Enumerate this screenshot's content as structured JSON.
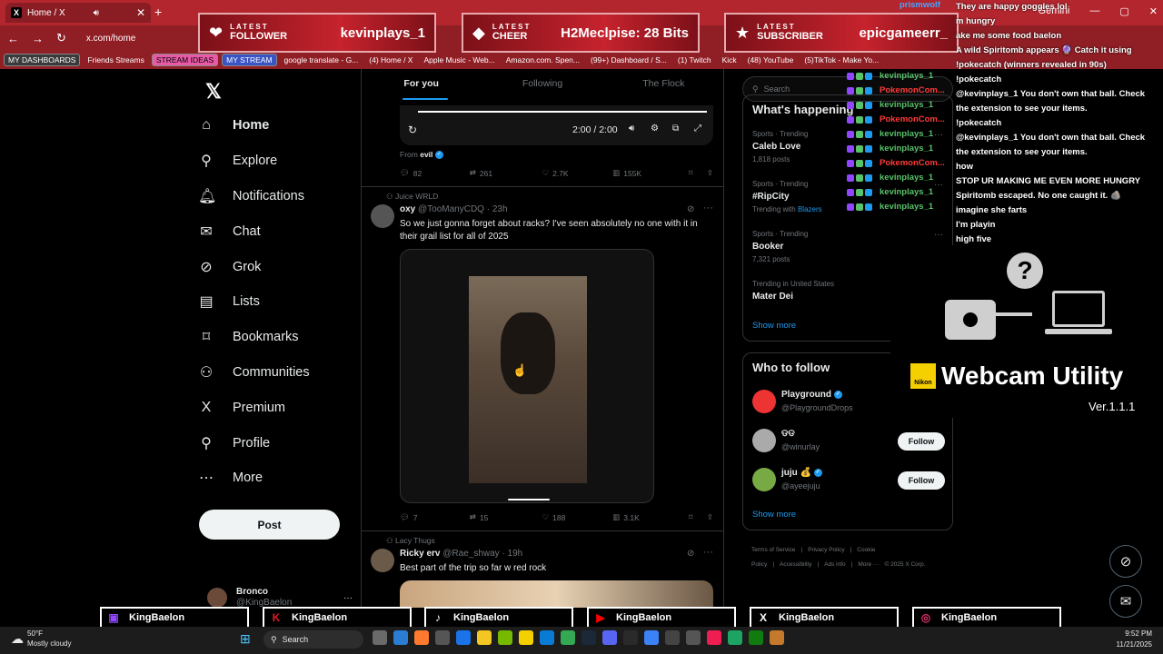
{
  "browser": {
    "tab_title": "Home / X",
    "url": "x.com/home",
    "bookmarks": [
      "MY DASHBOARDS",
      "Friends Streams",
      "STREAM IDEAS",
      "MY STREAM",
      "google translate - G...",
      "(4) Home / X",
      "Apple Music - Web...",
      "Amazon.com. Spen...",
      "(99+) Dashboard / S...",
      "(1) Twitch",
      "Kick",
      "(48) YouTube",
      "(5)TikTok - Make Yo..."
    ],
    "gemini_label": "Gemini"
  },
  "alerts": {
    "follower": {
      "label_top": "LATEST",
      "label": "FOLLOWER",
      "value": "kevinplays_1"
    },
    "cheer": {
      "label_top": "LATEST",
      "label": "CHEER",
      "value": "H2Meclpise: 28 Bits"
    },
    "subscriber": {
      "label_top": "LATEST",
      "label": "SUBSCRIBER",
      "value": "epicgameerr_"
    }
  },
  "nav": {
    "items": [
      {
        "label": "Home",
        "icon": "home-icon",
        "glyph": "⌂"
      },
      {
        "label": "Explore",
        "icon": "search-icon",
        "glyph": "⚲"
      },
      {
        "label": "Notifications",
        "icon": "bell-icon",
        "glyph": "🔔︎"
      },
      {
        "label": "Chat",
        "icon": "mail-icon",
        "glyph": "✉"
      },
      {
        "label": "Grok",
        "icon": "grok-icon",
        "glyph": "⊘"
      },
      {
        "label": "Lists",
        "icon": "list-icon",
        "glyph": "▤"
      },
      {
        "label": "Bookmarks",
        "icon": "bookmark-icon",
        "glyph": "⌑"
      },
      {
        "label": "Communities",
        "icon": "people-icon",
        "glyph": "⚇"
      },
      {
        "label": "Premium",
        "icon": "x-icon",
        "glyph": "X"
      },
      {
        "label": "Profile",
        "icon": "person-icon",
        "glyph": "⚲"
      },
      {
        "label": "More",
        "icon": "more-icon",
        "glyph": "⋯"
      }
    ],
    "post_label": "Post",
    "profile_name": "Bronco",
    "profile_handle": "@KingBaelon"
  },
  "feed": {
    "tabs": [
      "For you",
      "Following",
      "The Flock"
    ],
    "video_time": "2:00 / 2:00",
    "from_label": "From",
    "from_name": "evil",
    "tweet0_stats": {
      "replies": "82",
      "reposts": "261",
      "likes": "2.7K",
      "views": "155K"
    },
    "tweet1": {
      "context": "Juice WRLD",
      "name": "oxy",
      "handle": "@TooManyCDQ · 23h",
      "text": "So we just gonna forget about racks? I've seen absolutely no one with it in their grail list for all of 2025",
      "stats": {
        "replies": "7",
        "reposts": "15",
        "likes": "188",
        "views": "3.1K"
      }
    },
    "tweet2": {
      "context": "Lacy Thugs",
      "name": "Ricky erv",
      "handle": "@Rae_shway · 19h",
      "text": "Best part of the trip so far w red rock"
    }
  },
  "right": {
    "search_placeholder": "Search",
    "happening_title": "What's happening",
    "trends": [
      {
        "cat": "Sports · Trending",
        "name": "Caleb Love",
        "count": "1,818 posts"
      },
      {
        "cat": "Sports · Trending",
        "name": "#RipCity",
        "count": "Trending with",
        "extra": "Blazers"
      },
      {
        "cat": "Sports · Trending",
        "name": "Booker",
        "count": "7,321 posts"
      },
      {
        "cat": "Trending in United States",
        "name": "Mater Dei",
        "count": ""
      }
    ],
    "show_more": "Show more",
    "who_title": "Who to follow",
    "follow": [
      {
        "name": "Playground",
        "handle": "@PlaygroundDrops",
        "button": ""
      },
      {
        "name": "ଡଡ",
        "handle": "@winurlay",
        "button": "Follow"
      },
      {
        "name": "juju 💰",
        "handle": "@ayeejuju",
        "button": "Follow"
      }
    ],
    "footer": [
      "Terms of Service",
      "|",
      "Privacy Policy",
      "|",
      "Cookie Policy",
      "|",
      "Accessibility",
      "|",
      "Ads info",
      "|",
      "More ···",
      "© 2025 X Corp."
    ]
  },
  "chat": {
    "lines": [
      "They are happy goggles lol",
      "m hungry",
      "ake me some food baelon",
      "A wild Spiritomb appears 🔮 Catch it using",
      "!pokecatch (winners revealed in 90s)",
      "!pokecatch",
      "@kevinplays_1 You don't own that ball. Check",
      "the extension to see your items.",
      "!pokecatch",
      "@kevinplays_1 You don't own that ball. Check",
      "the extension to see your items.",
      "how",
      "STOP UR MAKING ME EVEN MORE HUNGRY",
      "Spiritomb escaped. No one caught it. 🪨",
      "imagine she farts",
      "I'm playin",
      "high five"
    ],
    "top_user": "prismwolf",
    "names": [
      {
        "name": "kevinplays_1",
        "color": "#59c36a"
      },
      {
        "name": "PokemonCom...",
        "color": "#ff3b3b"
      },
      {
        "name": "kevinplays_1",
        "color": "#59c36a"
      },
      {
        "name": "PokemonCom...",
        "color": "#ff3b3b"
      },
      {
        "name": "kevinplays_1",
        "color": "#59c36a"
      },
      {
        "name": "kevinplays_1",
        "color": "#59c36a"
      },
      {
        "name": "PokemonCom...",
        "color": "#ff3b3b"
      },
      {
        "name": "kevinplays_1",
        "color": "#59c36a"
      },
      {
        "name": "kevinplays_1",
        "color": "#59c36a"
      },
      {
        "name": "kevinplays_1",
        "color": "#59c36a"
      }
    ]
  },
  "webcam": {
    "brand": "Nikon",
    "title": "Webcam Utility",
    "version": "Ver.1.1.1"
  },
  "socials": [
    {
      "platform": "twitch",
      "handle": "KingBaelon",
      "glyph": "▣"
    },
    {
      "platform": "kick",
      "handle": "KingBaelon",
      "glyph": "K"
    },
    {
      "platform": "tiktok",
      "handle": "KingBaelon",
      "glyph": "♪"
    },
    {
      "platform": "youtube",
      "handle": "KingBaelon",
      "glyph": "▶"
    },
    {
      "platform": "x",
      "handle": "KingBaelon",
      "glyph": "X"
    },
    {
      "platform": "instagram",
      "handle": "KingBaelon",
      "glyph": "◎"
    }
  ],
  "taskbar": {
    "temp": "50°F",
    "weather": "Mostly cloudy",
    "search": "Search",
    "time": "9:52 PM",
    "date": "11/21/2025"
  },
  "colors": {
    "accent": "#1d9bf0",
    "brand_red": "#b3262e"
  }
}
